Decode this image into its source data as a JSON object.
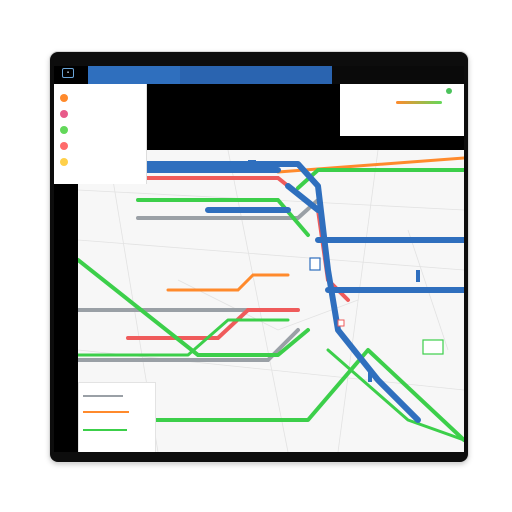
{
  "app": {
    "title_left": "",
    "title_center": "",
    "app_icon": "map-app-icon"
  },
  "sidebar": {
    "items": [
      {
        "label": "",
        "icon": "gear-icon",
        "color": "#ff8a2c"
      },
      {
        "label": "",
        "icon": "pin-icon",
        "color": "#e85b8a"
      },
      {
        "label": "",
        "icon": "layers-icon",
        "color": "#63d85a"
      },
      {
        "label": "",
        "icon": "bus-icon",
        "color": "#ff6b6b"
      },
      {
        "label": "",
        "icon": "star-icon",
        "color": "#ffd04a"
      }
    ]
  },
  "right_panel": {
    "line1": "",
    "line2": "",
    "line3": ""
  },
  "map": {
    "lines": [
      {
        "name": "",
        "color": "#2f6fbe"
      },
      {
        "name": "",
        "color": "#3ccf4a"
      },
      {
        "name": "",
        "color": "#ff8a2c"
      },
      {
        "name": "",
        "color": "#ef5b5b"
      },
      {
        "name": "",
        "color": "#9aa0a6"
      }
    ]
  },
  "legend": {
    "entries": [
      {
        "label": "",
        "color": "#9aa0a6"
      },
      {
        "label": "",
        "color": "#ff8a2c"
      },
      {
        "label": "",
        "color": "#3ccf4a"
      }
    ]
  },
  "colors": {
    "device": "#0d0d0d",
    "topbar": "#2f6fbe",
    "map_bg": "#f7f7f7"
  }
}
